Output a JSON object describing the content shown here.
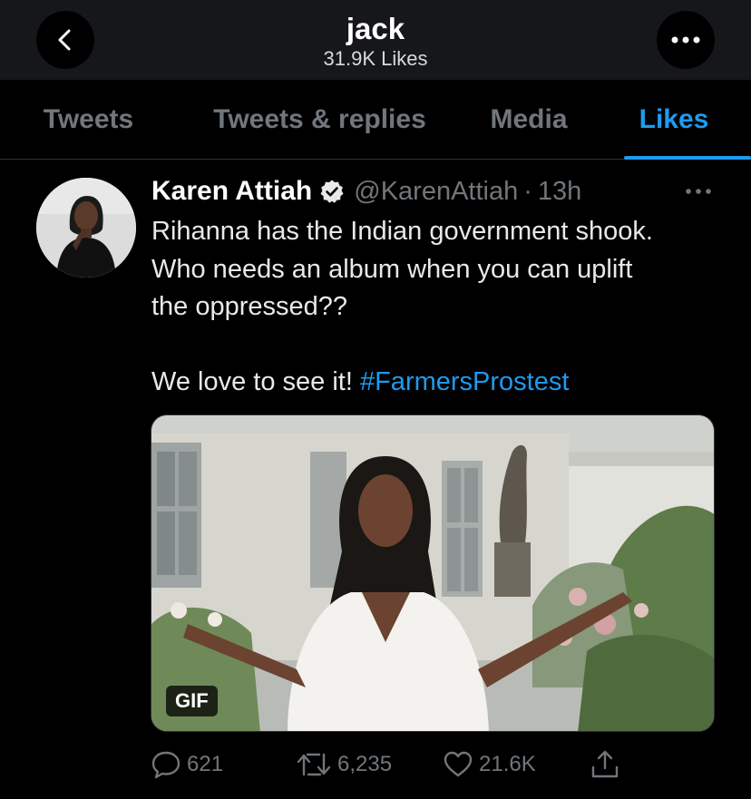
{
  "header": {
    "title": "jack",
    "subtitle": "31.9K Likes",
    "back_icon": "chevron-left-icon",
    "more_icon": "more-horizontal-icon"
  },
  "tabs": [
    {
      "label": "Tweets",
      "active": false
    },
    {
      "label": "Tweets & replies",
      "active": false
    },
    {
      "label": "Media",
      "active": false
    },
    {
      "label": "Likes",
      "active": true
    }
  ],
  "tweet": {
    "author_name": "Karen Attiah",
    "verified": true,
    "handle": "@KarenAttiah",
    "separator": "·",
    "time": "13h",
    "text_lines": [
      "Rihanna has the Indian government shook.",
      "Who needs an album when you can uplift",
      "the oppressed??"
    ],
    "text_last_prefix": "We love to see it! ",
    "hashtag": "#FarmersProstest",
    "media_badge": "GIF",
    "replies": "621",
    "retweets": "6,235",
    "likes": "21.6K",
    "share_icon": "share-icon"
  },
  "colors": {
    "accent": "#1d9bf0",
    "background": "#000000",
    "header_bg": "#15171a",
    "muted": "#71767b"
  }
}
